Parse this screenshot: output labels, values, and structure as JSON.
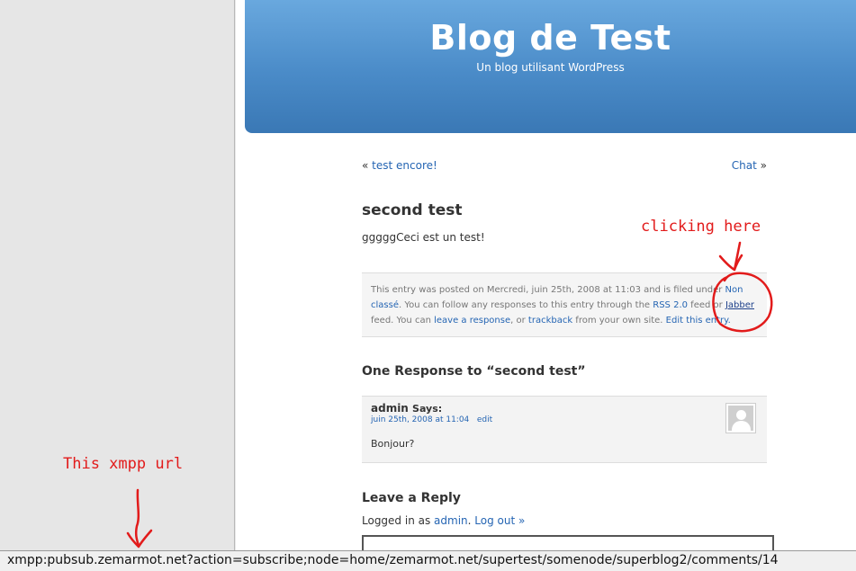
{
  "header": {
    "title": "Blog de Test",
    "description": "Un blog utilisant WordPress"
  },
  "nav": {
    "prev_arrow": "«",
    "prev_label": "test encore!",
    "next_label": "Chat",
    "next_arrow": "»"
  },
  "post": {
    "title": "second test",
    "body": "gggggCeci est un test!"
  },
  "postmeta": {
    "t1": "This entry was posted on Mercredi, juin 25th, 2008 at 11:03 and is filed under ",
    "category": "Non classé",
    "t2": ". You can follow any responses to this entry through the ",
    "rss": "RSS 2.0",
    "t3": " feed or ",
    "jabber": "Jabber",
    "t4": " feed. You can ",
    "leave_response": "leave a response",
    "t5": ", or ",
    "trackback": "trackback",
    "t6": " from your own site. ",
    "edit_entry": "Edit this entry."
  },
  "responses": {
    "title": "One Response to “second test”"
  },
  "comment": {
    "author": "admin",
    "says": "Says:",
    "date": "juin 25th, 2008 at 11:04",
    "edit": "edit",
    "text": "Bonjour?"
  },
  "reply": {
    "title": "Leave a Reply",
    "logged_prefix": "Logged in as ",
    "user": "admin",
    "logout": "Log out »"
  },
  "statusbar": {
    "url": "xmpp:pubsub.zemarmot.net?action=subscribe;node=home/zemarmot.net/supertest/somenode/superblog2/comments/14"
  },
  "annotations": {
    "clicking_here": "clicking here",
    "xmpp_url": "This xmpp url",
    "color": "#e21b1b"
  }
}
